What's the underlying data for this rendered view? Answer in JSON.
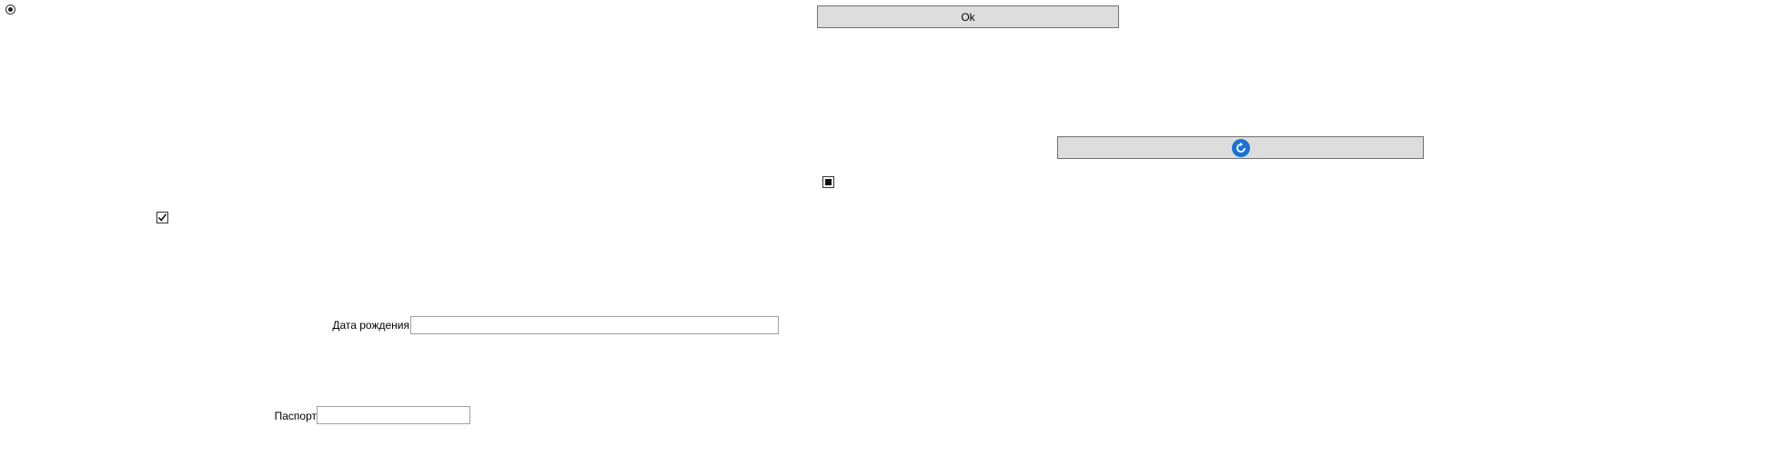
{
  "radio": {
    "checked": true
  },
  "ok_button": {
    "label": "Ok"
  },
  "refresh_button": {
    "icon": "refresh-icon",
    "accent": "#1a73d4"
  },
  "checkbox_1": {
    "state": "checked"
  },
  "checkbox_2": {
    "state": "indeterminate"
  },
  "birth_date": {
    "label": "Дата рождения",
    "value": ""
  },
  "passport": {
    "label": "Паспорт",
    "value": ""
  }
}
